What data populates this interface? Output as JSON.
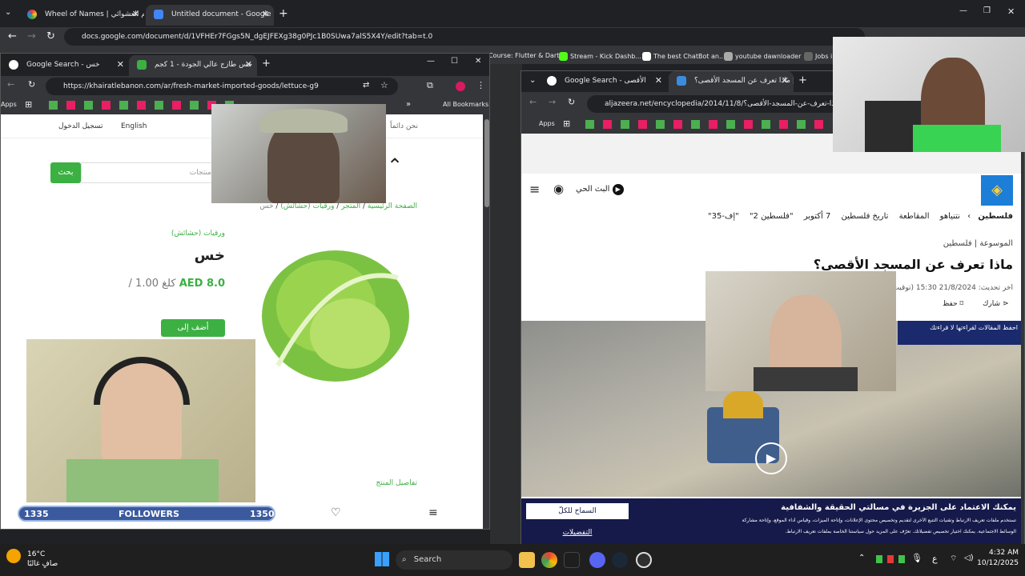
{
  "outer_tabs": [
    {
      "title": "Wheel of Names | بسم العشوائي"
    },
    {
      "title": "Untitled document - Google Do"
    }
  ],
  "outer_url": "docs.google.com/document/d/1VFHEr7FGgs5N_dgEJFEXg38g0PJc1B0SUwa7alS5X4Y/edit?tab=t.0",
  "outer_bookmarks": [
    "Course: Flutter & Dart",
    "Stream - Kick Dashb...",
    "The best ChatBot an...",
    "youtube dawnloader",
    "Jobs in"
  ],
  "left_window": {
    "tabs": [
      {
        "title": "Google Search - خس"
      },
      {
        "title": "خس طازج عالي الجودة - 1 كجم"
      }
    ],
    "url": "https://khairatlebanon.com/ar/fresh-market-imported-goods/lettuce-g9",
    "apps_label": "Apps",
    "all_bookmarks": "All Bookmarks",
    "top_bar": {
      "lang": "English",
      "login": "تسجيل الدخول",
      "tagline": "نحن دائماً"
    },
    "search": {
      "button": "بحث",
      "placeholder": "منتجات"
    },
    "breadcrumb": [
      "الصفحة الرئيسية",
      "المتجر",
      "ورقيات (حشائش)",
      "خس"
    ],
    "product": {
      "category": "ورقيات (حشائش)",
      "name": "خس",
      "price": "AED 8.0",
      "unit": "/ 1.00 كلغ",
      "add_button": "أضف إلى",
      "details": "تفاصيل المنتج"
    }
  },
  "right_window": {
    "tabs": [
      {
        "title": "Google Search - الأقصى"
      },
      {
        "title": "ماذا تعرف عن المسجد الأقصى؟ |"
      }
    ],
    "url": "aljazeera.net/encyclopedia/2014/11/8/ماذا-تعرف-عن-المسجد-الأقصى؟",
    "apps_label": "Apps",
    "live": "البث الحي",
    "nav": [
      "فلسطين",
      "نتنياهو",
      "المقاطعة",
      "تاريخ فلسطين",
      "7 أكتوبر",
      "\"فلسطين 2\"",
      "\"إف-35\""
    ],
    "breadcrumb": [
      "الموسوعة",
      "فلسطين"
    ],
    "headline": "ماذا تعرف عن المسجد الأقصى؟",
    "updated": "آخر تحديث: 21/8/2024 15:30 (توقيت م",
    "share": "شارك",
    "save": "حفظ",
    "save_tooltip": "احفظ المقالات لقراءتها لا قراءتك",
    "cookie": {
      "title": "يمكنك الاعتماد على الجزيرة في مسألتي الحقيقة والشفافية",
      "body1": "تستخدم ملفات تعريف الارتباط وتقنيات التتبع الأخرى لتقديم وتخصيص محتوى الإعلانات، وإتاحة الميزات، وقياس أداء الموقع، وإتاحة مشاركة",
      "body2": "الوسائط الاجتماعية. يمكنك اختيار تخصيص تفضيلاتك. تعرّف على المزيد حول سياستنا الخاصة بملفات تعريف الارتباط.",
      "allow_all": "السماح للكلّ",
      "prefs": "التفضيلات"
    }
  },
  "followers": {
    "left": "1335",
    "label": "FOLLOWERS",
    "right": "1350"
  },
  "taskbar": {
    "temp": "16°C",
    "weather": "صافٍ غالبًا",
    "search": "Search",
    "lang": "ع",
    "time": "4:32 AM",
    "date": "10/12/2025"
  }
}
